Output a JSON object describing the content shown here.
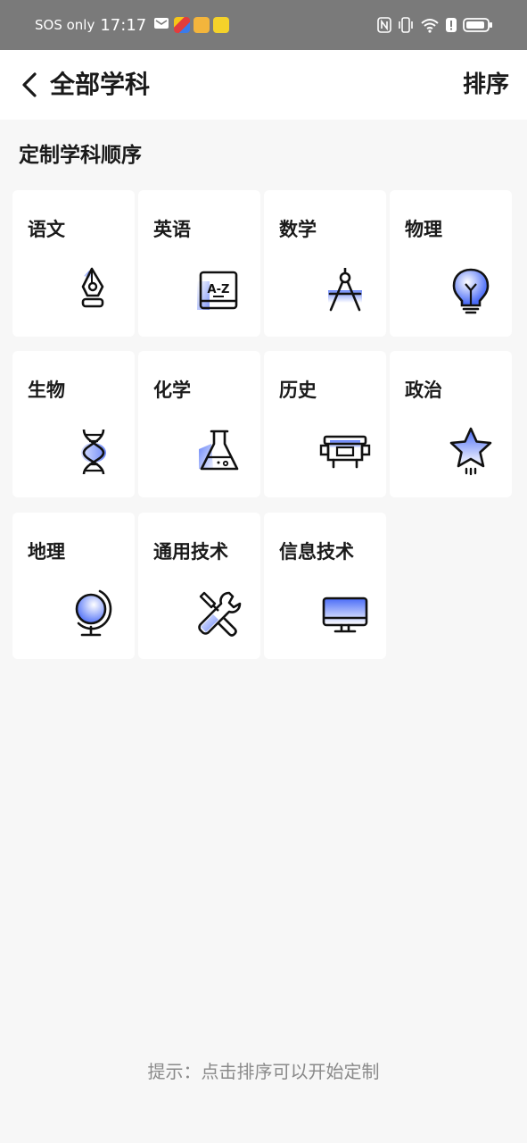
{
  "status_bar": {
    "sos": "SOS only",
    "time": "17:17"
  },
  "header": {
    "title": "全部学科",
    "sort_label": "排序"
  },
  "section": {
    "title": "定制学科顺序"
  },
  "subjects": [
    {
      "label": "语文",
      "icon": "pen-nib-icon"
    },
    {
      "label": "英语",
      "icon": "dictionary-icon"
    },
    {
      "label": "数学",
      "icon": "compass-icon"
    },
    {
      "label": "物理",
      "icon": "lightbulb-icon"
    },
    {
      "label": "生物",
      "icon": "dna-icon"
    },
    {
      "label": "化学",
      "icon": "flask-icon"
    },
    {
      "label": "历史",
      "icon": "bronze-vessel-icon"
    },
    {
      "label": "政治",
      "icon": "star-icon"
    },
    {
      "label": "地理",
      "icon": "globe-icon"
    },
    {
      "label": "通用技术",
      "icon": "tools-icon"
    },
    {
      "label": "信息技术",
      "icon": "monitor-icon"
    }
  ],
  "hint": "提示：点击排序可以开始定制",
  "colors": {
    "accent_blue": "#4a6cf7",
    "icon_stroke": "#111111",
    "status_bar_bg": "#7a7a7a",
    "page_bg": "#f7f7f7"
  }
}
